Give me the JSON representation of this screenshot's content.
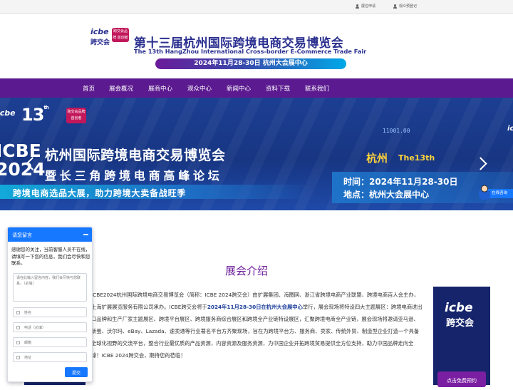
{
  "topbar": {
    "links": [
      {
        "label": "展位申请"
      },
      {
        "label": "观众预登记"
      }
    ]
  },
  "header": {
    "logo_icbe": "icbe",
    "logo_cn": "跨交会",
    "logo_badge": "跨交会品牌 首创者",
    "title_cn": "第十三届杭州国际跨境电商交易博览会",
    "title_en": "The 13th HangZhou International Cross-border E-Commerce Trade Fair",
    "date_pill": "2024年11月28-30日   杭州大会展中心"
  },
  "nav": {
    "items": [
      {
        "label": "首页"
      },
      {
        "label": "展会概况"
      },
      {
        "label": "展商中心"
      },
      {
        "label": "观众中心"
      },
      {
        "label": "新闻中心"
      },
      {
        "label": "资料下载"
      },
      {
        "label": "联系我们"
      }
    ]
  },
  "banner": {
    "icbe_small": "icbe",
    "edition": "13",
    "edition_sup": "th",
    "badge": "跨交会品牌 首创者",
    "icbe_big_1": "ICBE",
    "icbe_big_2": "2024",
    "title1": "杭州国际跨境电商交易博览会",
    "title2": "暨长三角跨境电商高峰论坛",
    "slogan": "跨境电商选品大展，助力跨境大卖备战旺季",
    "digits": "11001.00",
    "city": "杭州",
    "city_en": "The13th",
    "time": "时间：2024年11月28-30日",
    "place": "地点：杭州大会展中心",
    "icbe_right": "icbe"
  },
  "online_service": "在线咨询",
  "section": {
    "title": "展会介绍",
    "intro_part1": "ICBE2024杭州国际跨境电商交易博览会（简称：ICBE 2024跨交会）由扩展集团、海圈网、浙江省跨境电商产业联盟、跨境电商百人会主办，上海扩展展览服务有限公司承办。ICBE跨交会将于",
    "intro_highlight": "2024年11月28-30日在杭州大会展中心",
    "intro_part2": "举行，展会现场将特设四大主题展区：跨境电商进出口品牌和生产厂家主题展区、跨境平台展区、跨境服务商综合展区和跨境全产业链特设展区，汇聚跨境电商全产业链，展会现场将邀请亚马逊、新蛋、沃尔玛、eBay、Lazada、速卖通等行业著名平台方齐聚现场，旨在为跨境平台方、服务商、卖家、传统外贸、制造型企业打造一个具备全球化视野的交流平台，整合行业最优质的产品资源，内容资源及服务资源，为中国企业开拓跨境贸易提供全方位支持，助力中国品牌走向全球！ICBE 2024跨交会，期待您的莅临！"
  },
  "side_card": {
    "icbe": "icbe",
    "cn": "跨交会",
    "button": "点击免费预约"
  },
  "chat": {
    "title": "请您留言",
    "message": "感谢您的关注，当前客服人员不在线，请填写一下您的信息，我们会尽快和您联系。",
    "textarea_placeholder": "请在此输入留言内容，我们会尽快与您联系。（必填）",
    "fields": [
      {
        "placeholder": "姓名"
      },
      {
        "placeholder": "电话（必填）"
      },
      {
        "placeholder": "邮箱"
      },
      {
        "placeholder": "地址"
      }
    ],
    "submit": "提交"
  },
  "colors": {
    "nav_bg": "#5b1a8f",
    "brand_blue": "#2a2f8f",
    "chat_blue": "#1677ff",
    "section_title": "#6a1b9a"
  }
}
